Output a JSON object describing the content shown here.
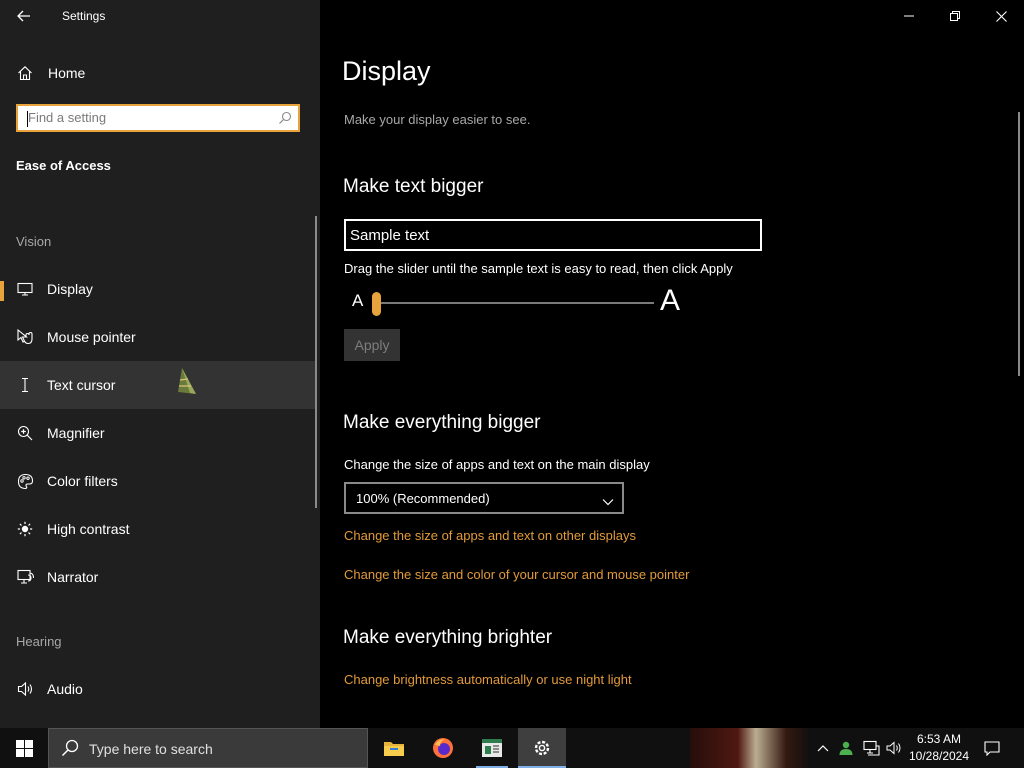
{
  "window": {
    "app_title": "Settings",
    "controls": {
      "minimize": "minimize",
      "restore": "restore",
      "close": "close"
    }
  },
  "sidebar": {
    "home_label": "Home",
    "search_placeholder": "Find a setting",
    "category": "Ease of Access",
    "groups": {
      "vision": "Vision",
      "hearing": "Hearing"
    },
    "items": [
      {
        "label": "Display",
        "icon": "monitor-icon",
        "selected": true
      },
      {
        "label": "Mouse pointer",
        "icon": "mouse-pointer-icon"
      },
      {
        "label": "Text cursor",
        "icon": "text-cursor-icon",
        "hover": true
      },
      {
        "label": "Magnifier",
        "icon": "magnifier-icon"
      },
      {
        "label": "Color filters",
        "icon": "color-filters-icon"
      },
      {
        "label": "High contrast",
        "icon": "high-contrast-icon"
      },
      {
        "label": "Narrator",
        "icon": "narrator-icon"
      },
      {
        "label": "Audio",
        "icon": "speaker-icon"
      }
    ]
  },
  "main": {
    "title": "Display",
    "subtitle": "Make your display easier to see.",
    "text_section": {
      "heading": "Make text bigger",
      "sample_text": "Sample text",
      "hint": "Drag the slider until the sample text is easy to read, then click Apply",
      "small_a": "A",
      "large_a": "A",
      "slider_value_fraction": 0,
      "apply_label": "Apply"
    },
    "scale_section": {
      "heading": "Make everything bigger",
      "description": "Change the size of apps and text on the main display",
      "selected_option": "100% (Recommended)",
      "link_other_displays": "Change the size of apps and text on other displays",
      "link_cursor": "Change the size and color of your cursor and mouse pointer"
    },
    "brightness_section": {
      "heading": "Make everything brighter",
      "link_night_light": "Change brightness automatically or use night light"
    }
  },
  "taskbar": {
    "search_placeholder": "Type here to search",
    "apps": [
      {
        "name": "file-explorer-icon"
      },
      {
        "name": "firefox-icon"
      },
      {
        "name": "document-app-icon"
      },
      {
        "name": "settings-icon",
        "active": true
      }
    ],
    "clock": {
      "time": "6:53 AM",
      "date": "10/28/2024"
    }
  },
  "colors": {
    "accent": "#e8a33c",
    "link": "#e29a3b",
    "sidebar_bg": "#1f1f1f",
    "main_bg": "#000000"
  }
}
